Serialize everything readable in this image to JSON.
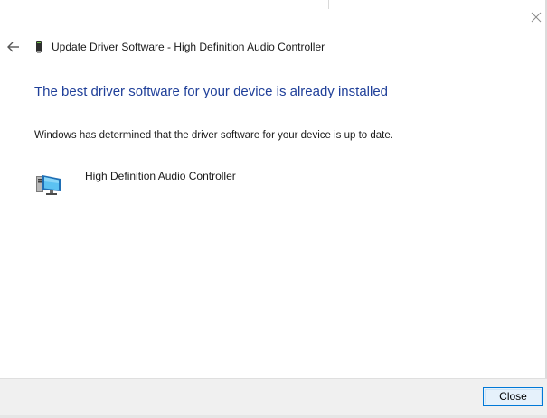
{
  "window": {
    "title": "Update Driver Software - High Definition Audio Controller"
  },
  "content": {
    "heading": "The best driver software for your device is already installed",
    "message": "Windows has determined that the driver software for your device is up to date.",
    "device_name": "High Definition Audio Controller"
  },
  "footer": {
    "close_label": "Close"
  },
  "icons": {
    "back": "back-arrow-icon",
    "close": "close-icon",
    "title_device": "device-icon",
    "device": "computer-device-icon"
  },
  "colors": {
    "heading": "#1f3f99",
    "button_border": "#0078d7",
    "button_fill": "#e5f1fb",
    "footer_bg": "#f0f0f0"
  }
}
